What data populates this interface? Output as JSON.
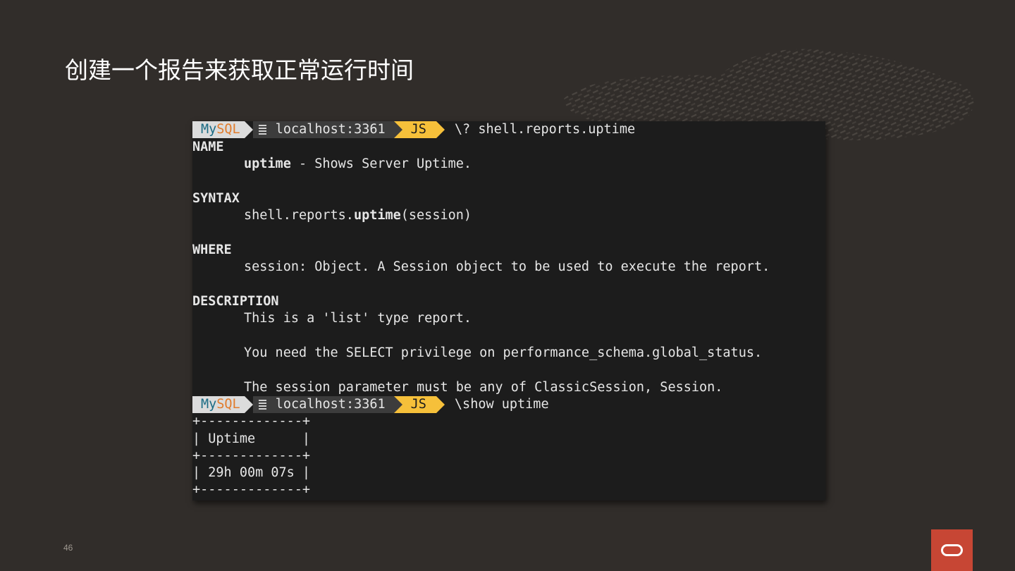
{
  "slide": {
    "title": "创建一个报告来获取正常运行时间",
    "page_number": "46"
  },
  "colors": {
    "background": "#312d2a",
    "terminal_bg": "#1c1c1c",
    "prompt_mysql_bg": "#dcdcdc",
    "prompt_host_bg": "#3c3c3c",
    "prompt_js_bg": "#f6c03a",
    "oracle_red": "#c74634"
  },
  "terminal": {
    "prompt": {
      "my": "My",
      "sql": "SQL",
      "host_icon": "server-icon",
      "host": "localhost:3361",
      "mode": "JS"
    },
    "command1": "\\? shell.reports.uptime",
    "help": {
      "name_heading": "NAME",
      "name_cmd": "uptime",
      "name_desc": " - Shows Server Uptime.",
      "syntax_heading": "SYNTAX",
      "syntax_prefix": "shell.reports.",
      "syntax_fn": "uptime",
      "syntax_args": "(session)",
      "where_heading": "WHERE",
      "where_text": "session: Object. A Session object to be used to execute the report.",
      "description_heading": "DESCRIPTION",
      "desc_line1": "This is a 'list' type report.",
      "desc_line2": "You need the SELECT privilege on performance_schema.global_status.",
      "desc_line3": "The session parameter must be any of ClassicSession, Session."
    },
    "command2": "\\show uptime",
    "result": {
      "border": "+-------------+",
      "header": "| Uptime      |",
      "value": "| 29h 00m 07s |"
    }
  },
  "logo": {
    "name": "oracle-logo"
  }
}
